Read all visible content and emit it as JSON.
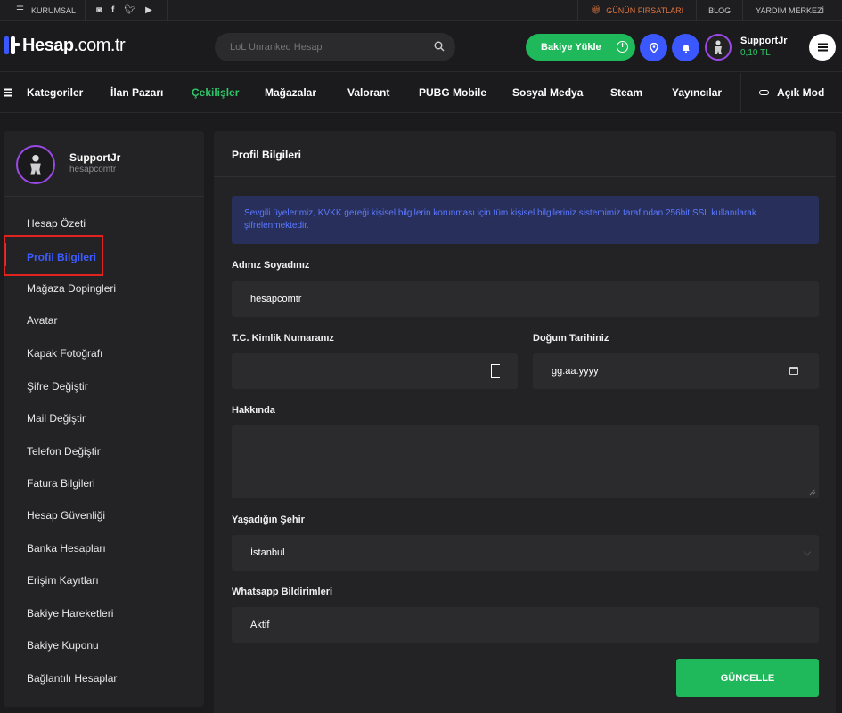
{
  "topbar": {
    "corporate": "KURUMSAL",
    "social_icons": [
      "instagram-icon",
      "facebook-icon",
      "twitter-icon",
      "youtube-icon"
    ],
    "deals": "GÜNÜN FIRSATLARI",
    "blog": "BLOG",
    "help": "YARDIM MERKEZİ"
  },
  "header": {
    "logo_bold": "Hesap",
    "logo_light": ".com.tr",
    "search_placeholder": "LoL Unranked Hesap",
    "topup_label": "Bakiye Yükle",
    "user_name": "SupportJr",
    "balance": "0,10 TL"
  },
  "nav": {
    "items": [
      "Kategoriler",
      "İlan Pazarı",
      "Çekilişler",
      "Mağazalar",
      "Valorant",
      "PUBG Mobile",
      "Sosyal Medya",
      "Steam",
      "Yayıncılar"
    ],
    "active_item": "Çekilişler",
    "mode_label": "Açık Mod"
  },
  "sidebar": {
    "name": "SupportJr",
    "username": "hesapcomtr",
    "items": [
      "Hesap Özeti",
      "Profil Bilgileri",
      "Mağaza Dopingleri",
      "Avatar",
      "Kapak Fotoğrafı",
      "Şifre Değiştir",
      "Mail Değiştir",
      "Telefon Değiştir",
      "Fatura Bilgileri",
      "Hesap Güvenliği",
      "Banka Hesapları",
      "Erişim Kayıtları",
      "Bakiye Hareketleri",
      "Bakiye Kuponu",
      "Bağlantılı Hesaplar"
    ],
    "active_item": "Profil Bilgileri"
  },
  "main": {
    "title": "Profil Bilgileri",
    "notice": "Sevgili üyelerimiz, KVKK gereği kişisel bilgilerin korunması için tüm kişisel bilgileriniz sistemimiz tarafından 256bit SSL kullanılarak şifrelenmektedir.",
    "fullname_label": "Adınız Soyadınız",
    "fullname_value": "hesapcomtr",
    "tc_label": "T.C. Kimlik Numaranız",
    "tc_value": "",
    "birth_label": "Doğum Tarihiniz",
    "birth_placeholder": "gg.aa.yyyy",
    "about_label": "Hakkında",
    "about_value": "",
    "city_label": "Yaşadığın Şehir",
    "city_value": "İstanbul",
    "whatsapp_label": "Whatsapp Bildirimleri",
    "whatsapp_value": "Aktif",
    "update_button": "GÜNCELLE"
  },
  "colors": {
    "accent_green": "#1fb85a",
    "accent_blue": "#3b57ff",
    "highlight_red": "#e0231f",
    "notice_text": "#5a79ff"
  }
}
